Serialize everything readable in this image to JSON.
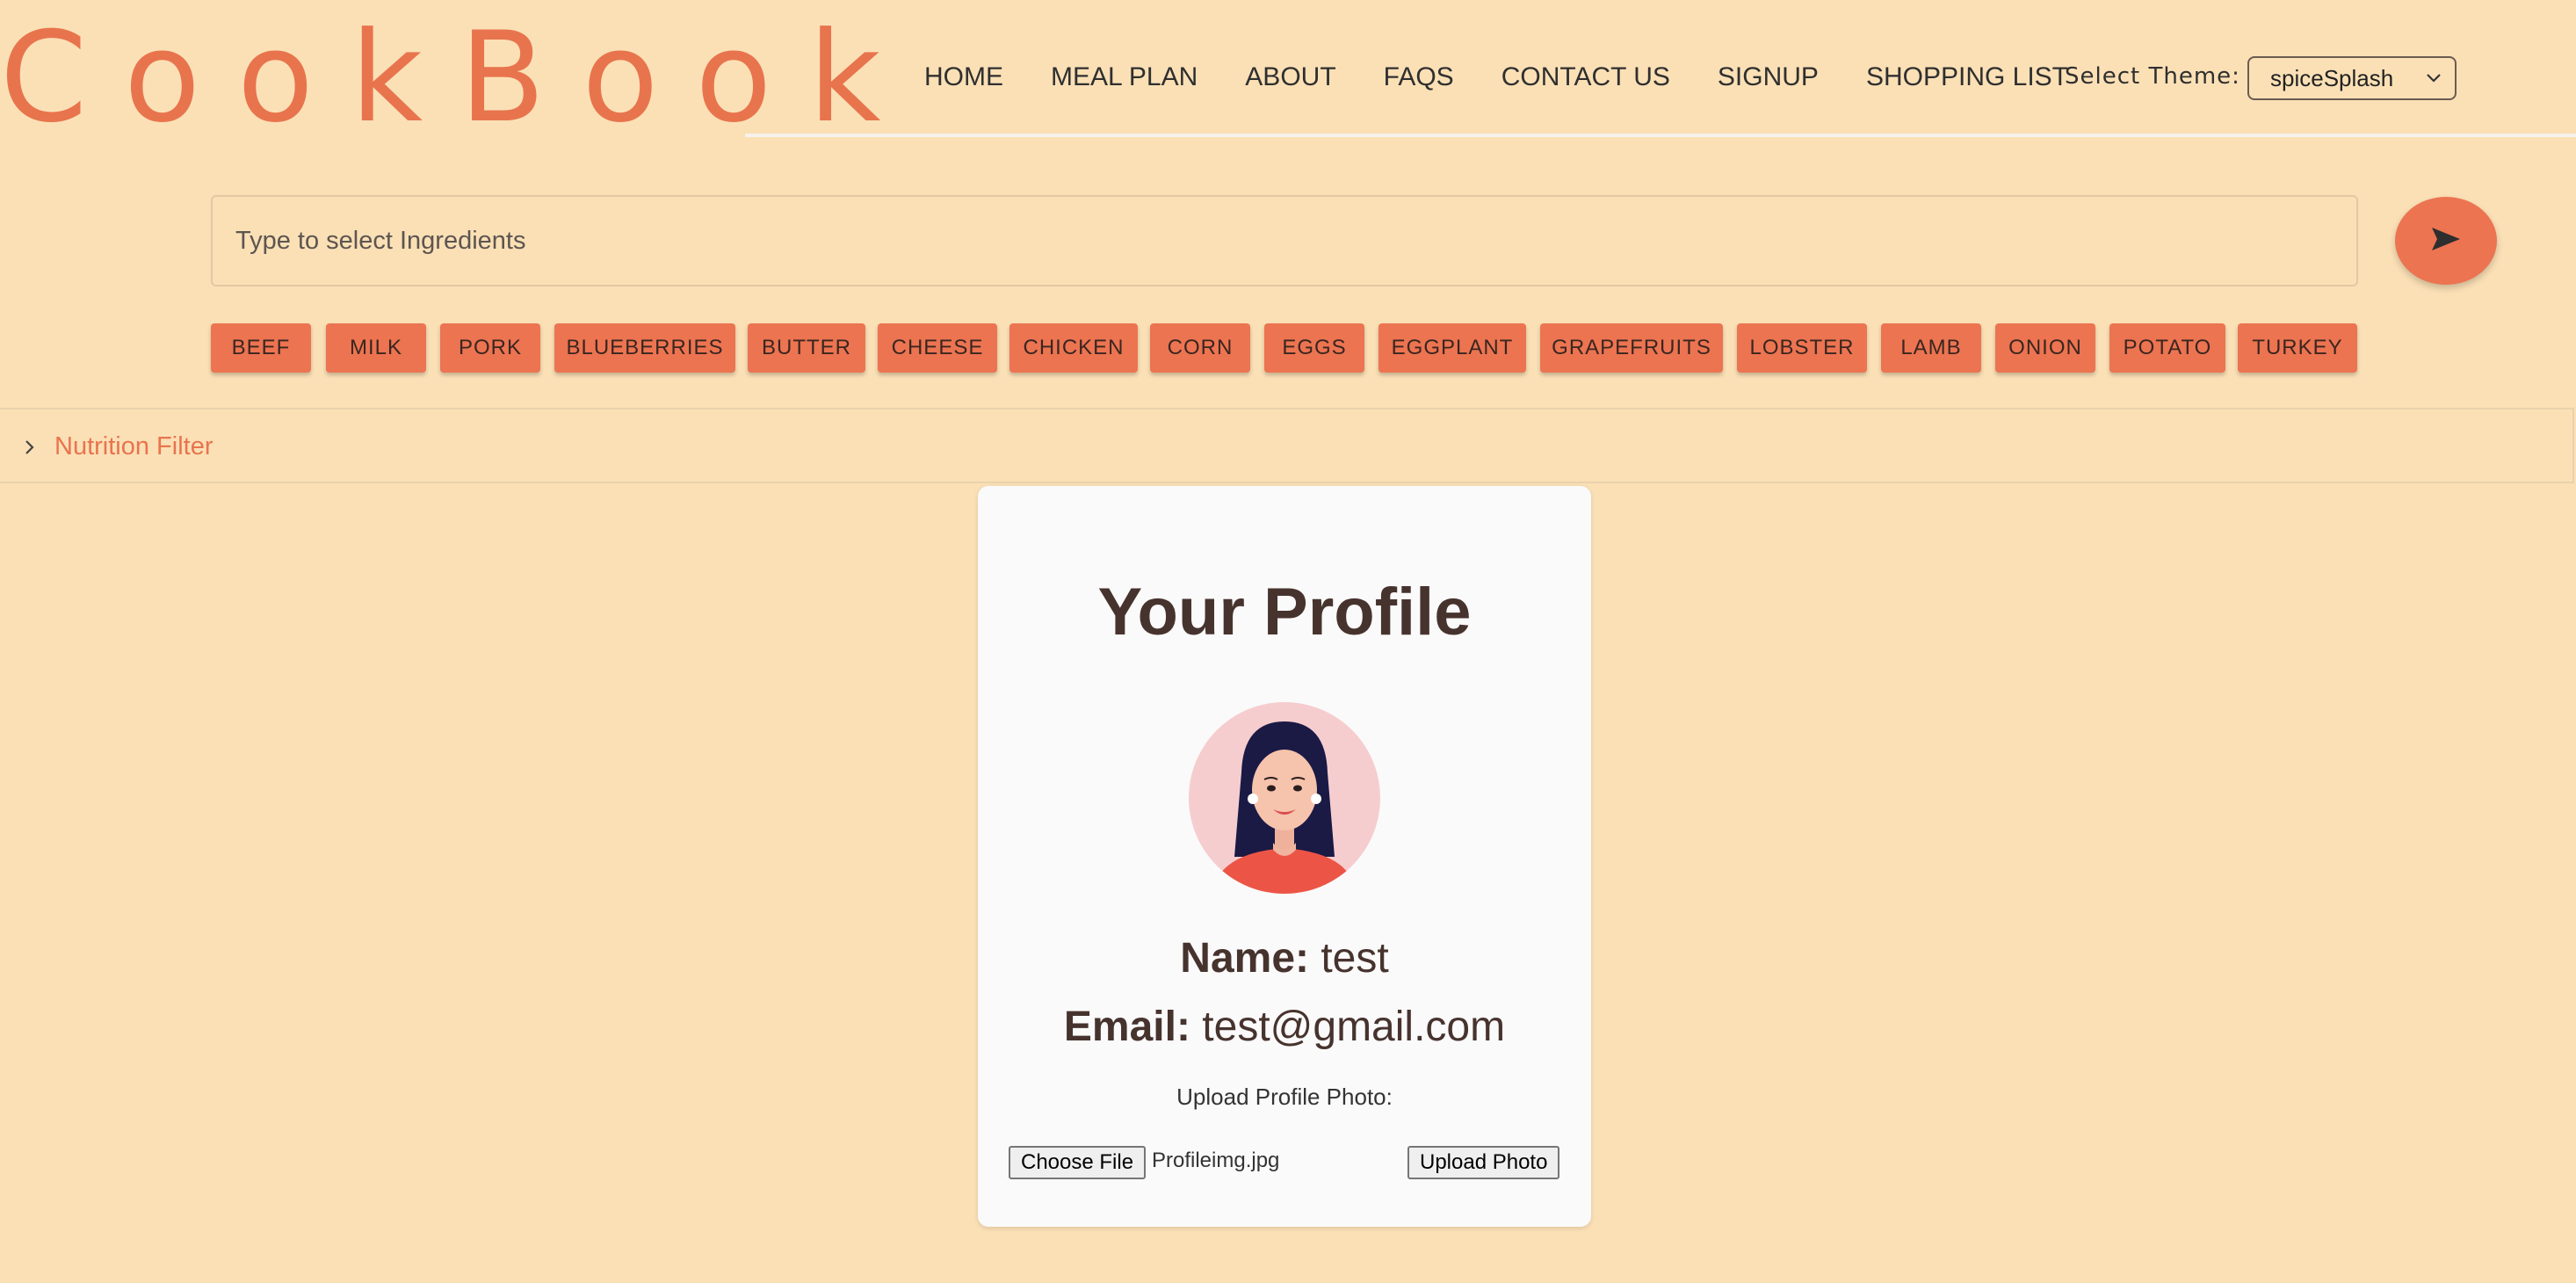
{
  "app": {
    "logo": "CookBook"
  },
  "nav": {
    "items": [
      "HOME",
      "MEAL PLAN",
      "ABOUT",
      "FAQS",
      "CONTACT US",
      "SIGNUP",
      "SHOPPING LIST"
    ],
    "theme_label": "Select Theme:",
    "theme_value": "spiceSplash"
  },
  "search": {
    "placeholder": "Type to select Ingredients",
    "send_icon": "send-arrow-icon"
  },
  "ingredients": [
    "BEEF",
    "MILK",
    "PORK",
    "BLUEBERRIES",
    "BUTTER",
    "CHEESE",
    "CHICKEN",
    "CORN",
    "EGGS",
    "EGGPLANT",
    "GRAPEFRUITS",
    "LOBSTER",
    "LAMB",
    "ONION",
    "POTATO",
    "TURKEY"
  ],
  "filter": {
    "label": "Nutrition Filter",
    "icon": "chevron-right-icon"
  },
  "profile": {
    "title": "Your Profile",
    "name_label": "Name:",
    "name_value": "test",
    "email_label": "Email:",
    "email_value": "test@gmail.com",
    "upload_label": "Upload Profile Photo:",
    "choose_file": "Choose File",
    "file_name": "Profileimg.jpg",
    "upload_button": "Upload Photo"
  },
  "colors": {
    "background": "#fbe0b6",
    "accent": "#ec7451",
    "card": "#fafafa",
    "text": "#47332e"
  }
}
